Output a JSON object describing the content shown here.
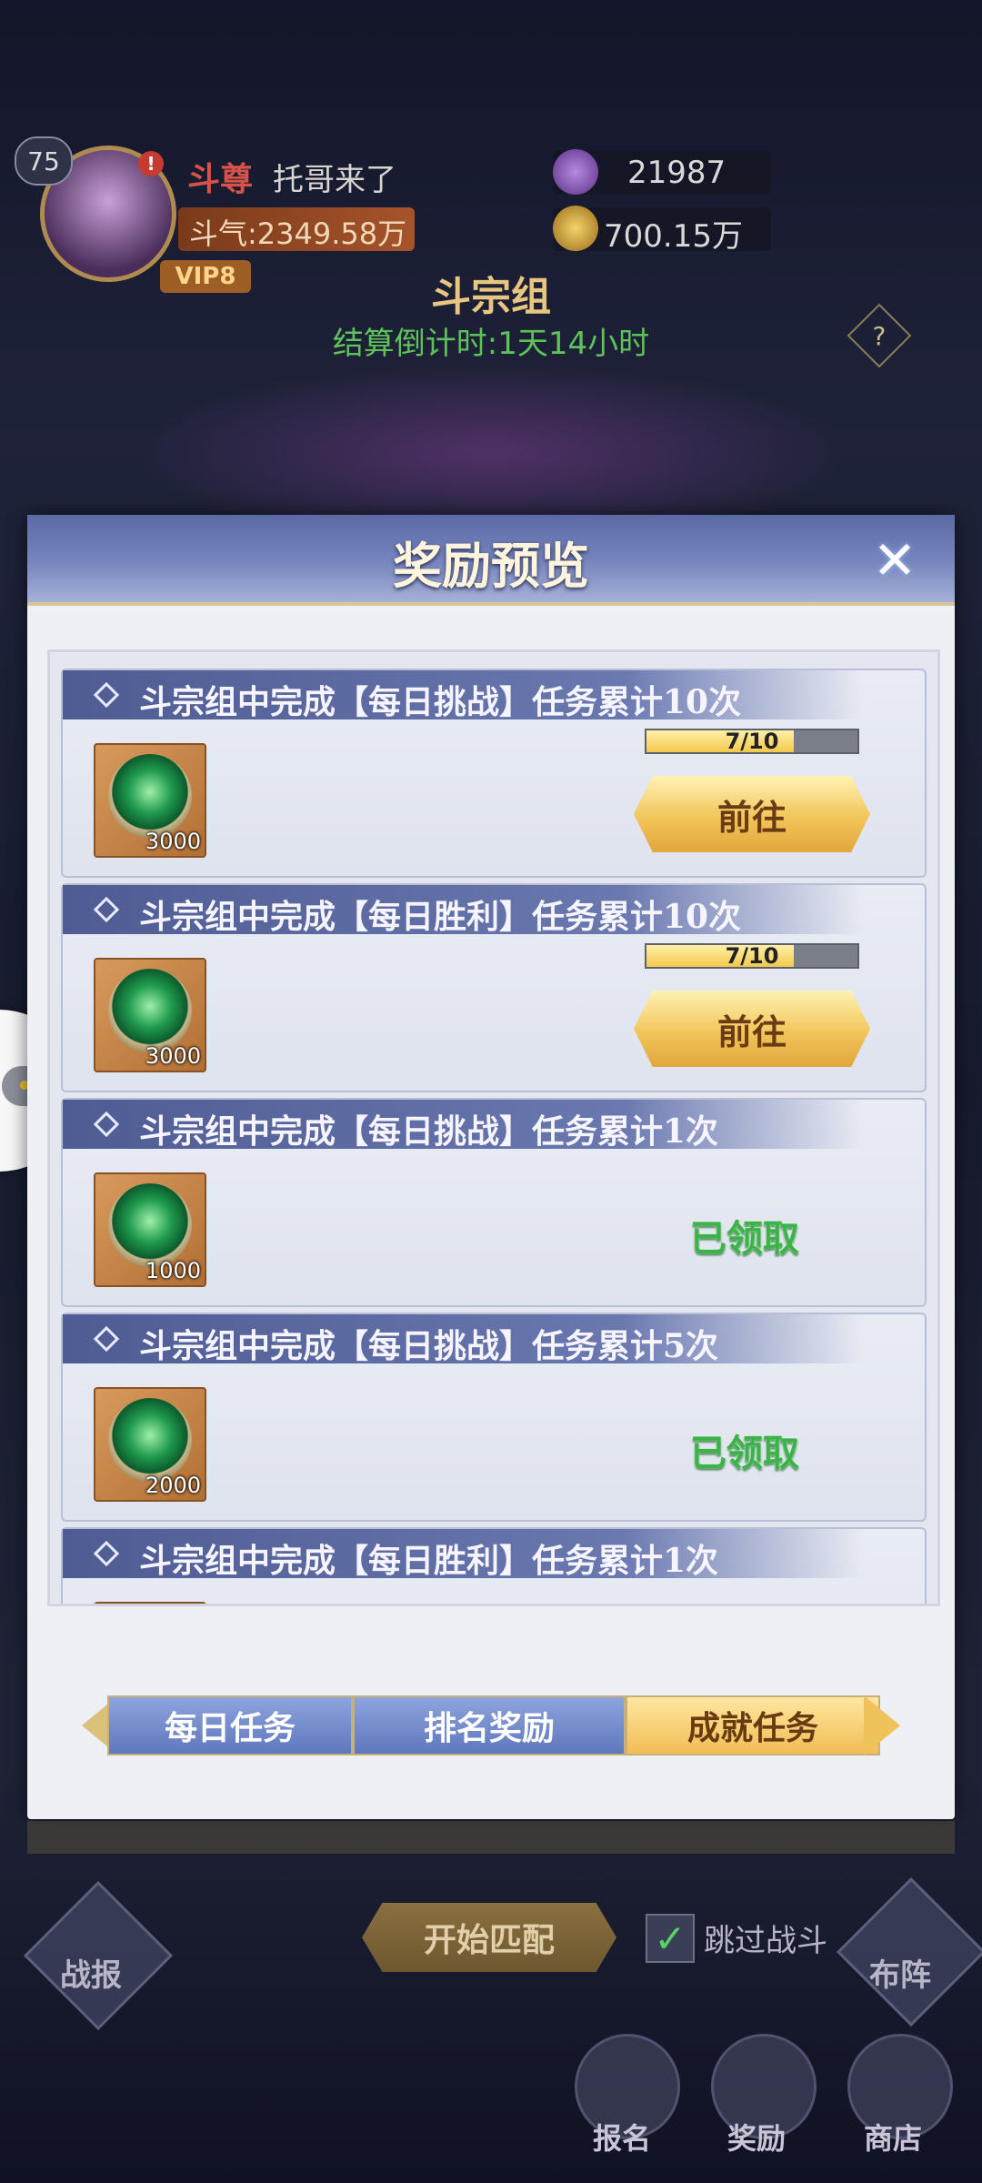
{
  "hud": {
    "level": "75",
    "alert": "!",
    "rank_title": "斗尊",
    "player_name": "托哥来了",
    "power": "斗气:2349.58万",
    "vip": "VIP8",
    "resource_1": "21987",
    "resource_2": "700.15万",
    "group_title": "斗宗组",
    "countdown": "结算倒计时:1天14小时",
    "help": "?"
  },
  "dialog": {
    "title": "奖励预览",
    "close": "✕",
    "tasks": [
      {
        "title": "斗宗组中完成【每日挑战】任务累计10次",
        "qty": "3000",
        "progress_label": "7/10",
        "progress": 0.7,
        "action": "前往"
      },
      {
        "title": "斗宗组中完成【每日胜利】任务累计10次",
        "qty": "3000",
        "progress_label": "7/10",
        "progress": 0.7,
        "action": "前往"
      },
      {
        "title": "斗宗组中完成【每日挑战】任务累计1次",
        "qty": "1000",
        "status": "已领取"
      },
      {
        "title": "斗宗组中完成【每日挑战】任务累计5次",
        "qty": "2000",
        "status": "已领取"
      },
      {
        "title": "斗宗组中完成【每日胜利】任务累计1次",
        "qty": "",
        "status": ""
      }
    ],
    "tabs": [
      {
        "label": "每日任务",
        "active": false
      },
      {
        "label": "排名奖励",
        "active": false
      },
      {
        "label": "成就任务",
        "active": true
      }
    ]
  },
  "bottom": {
    "battle_report": "战报",
    "match_button": "开始匹配",
    "skip_check": "✓",
    "skip_label": "跳过战斗",
    "formation": "布阵",
    "signup": "报名",
    "rewards": "奖励",
    "shop": "商店"
  },
  "colors": {
    "accent_gold": "#f2c55a",
    "header_blue": "#5b6aa6",
    "claimed_green": "#3bb34a"
  }
}
